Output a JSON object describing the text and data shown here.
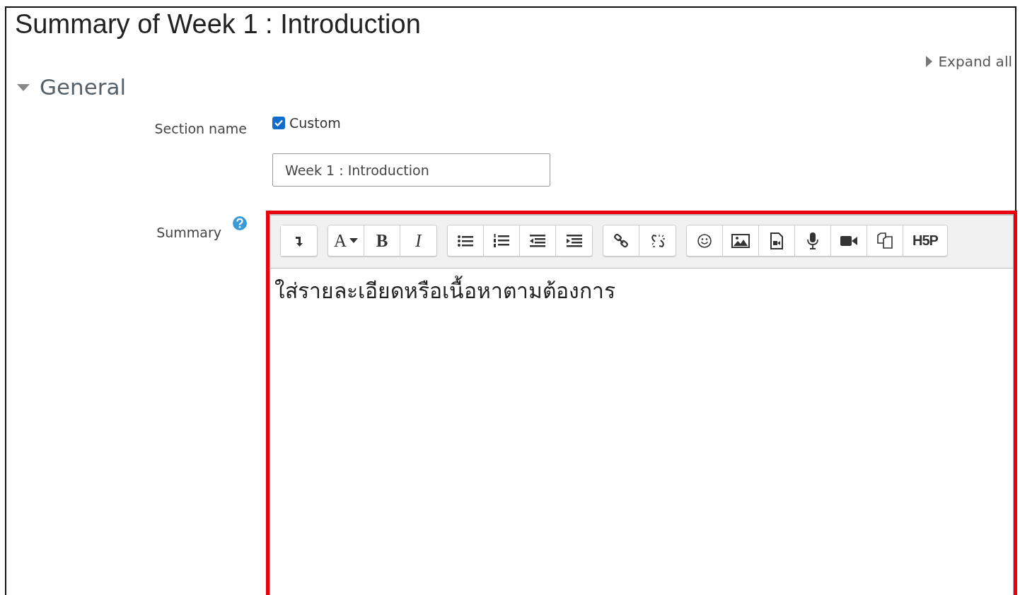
{
  "page_title": "Summary of Week 1 : Introduction",
  "expand_all": {
    "label": "Expand all"
  },
  "section": {
    "title": "General",
    "expanded": true
  },
  "section_name": {
    "label": "Section name",
    "custom": {
      "label": "Custom",
      "checked": true
    },
    "value": "Week 1 : Introduction"
  },
  "summary": {
    "label": "Summary",
    "toolbar": [
      [
        {
          "kind": "toggle"
        }
      ],
      [
        {
          "kind": "font",
          "label": "A"
        },
        {
          "kind": "bold",
          "label": "B"
        },
        {
          "kind": "italic",
          "label": "I"
        }
      ],
      [
        {
          "kind": "bullets"
        },
        {
          "kind": "numbers"
        },
        {
          "kind": "outdent"
        },
        {
          "kind": "indent"
        }
      ],
      [
        {
          "kind": "link"
        },
        {
          "kind": "unlink"
        }
      ],
      [
        {
          "kind": "emoji"
        },
        {
          "kind": "image"
        },
        {
          "kind": "media"
        },
        {
          "kind": "audio"
        },
        {
          "kind": "video"
        },
        {
          "kind": "files"
        },
        {
          "kind": "h5p",
          "label": "H5P"
        }
      ]
    ],
    "content": "ใส่รายละเอียดหรือเนื้อหาตามต้องการ"
  }
}
